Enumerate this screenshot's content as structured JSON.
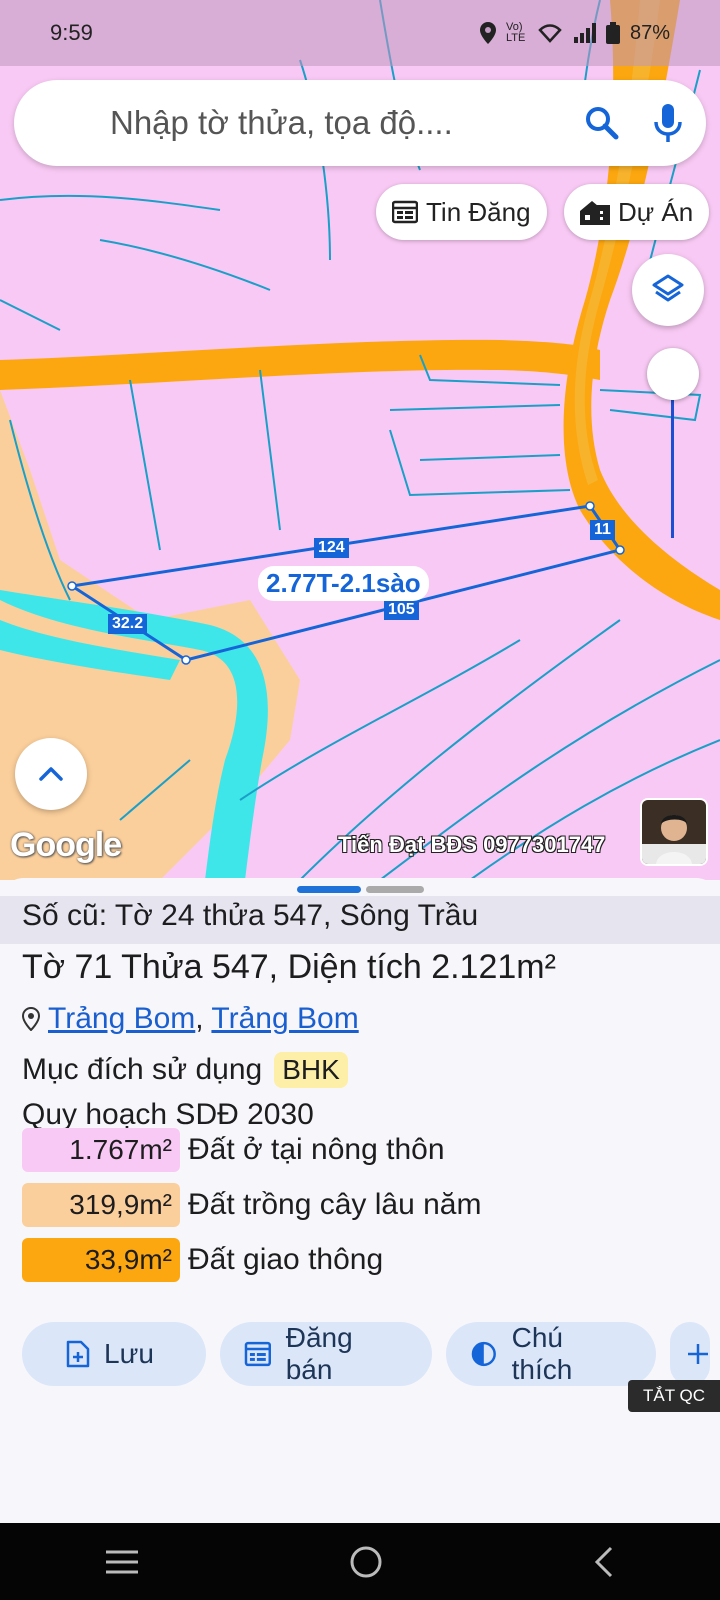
{
  "status_bar": {
    "time": "9:59",
    "network": "Vo) LTE",
    "battery": "87%"
  },
  "search": {
    "placeholder": "Nhập tờ thửa, tọa độ...."
  },
  "chips": {
    "listings": "Tin Đăng",
    "projects": "Dự Án"
  },
  "map": {
    "edge_labels": [
      "124",
      "11",
      "105",
      "32.2"
    ],
    "area_label": "2.77T-2.1sào",
    "google": "Google",
    "watermark": "Tiến Đạt BĐS 0977301747"
  },
  "parcel": {
    "old_info": "Số cũ: Tờ 24 thửa 547, Sông Trầu",
    "title": "Tờ 71 Thửa 547, Diện tích 2.121m²",
    "location": [
      "Trảng Bom",
      "Trảng Bom"
    ],
    "location_sep": ",",
    "purpose_label": "Mục đích sử dụng",
    "purpose_code": "BHK",
    "plan_title": "Quy hoạch SDĐ 2030",
    "zones": [
      {
        "amount": "1.767m²",
        "name": "Đất ở tại nông thôn",
        "color": "#f8c9f4"
      },
      {
        "amount": "319,9m²",
        "name": "Đất trồng cây lâu năm",
        "color": "#fbcf9b"
      },
      {
        "amount": "33,9m²",
        "name": "Đất giao thông",
        "color": "#fca70f"
      }
    ]
  },
  "actions": {
    "save": "Lưu",
    "post": "Đăng bán",
    "legend": "Chú thích"
  },
  "ad_toggle": "TẮT QC",
  "colors": {
    "residential": "#f8c9f4",
    "perennial": "#fbcf9b",
    "road": "#fca70f",
    "water": "#3ee6ea",
    "accent": "#1565d8"
  }
}
